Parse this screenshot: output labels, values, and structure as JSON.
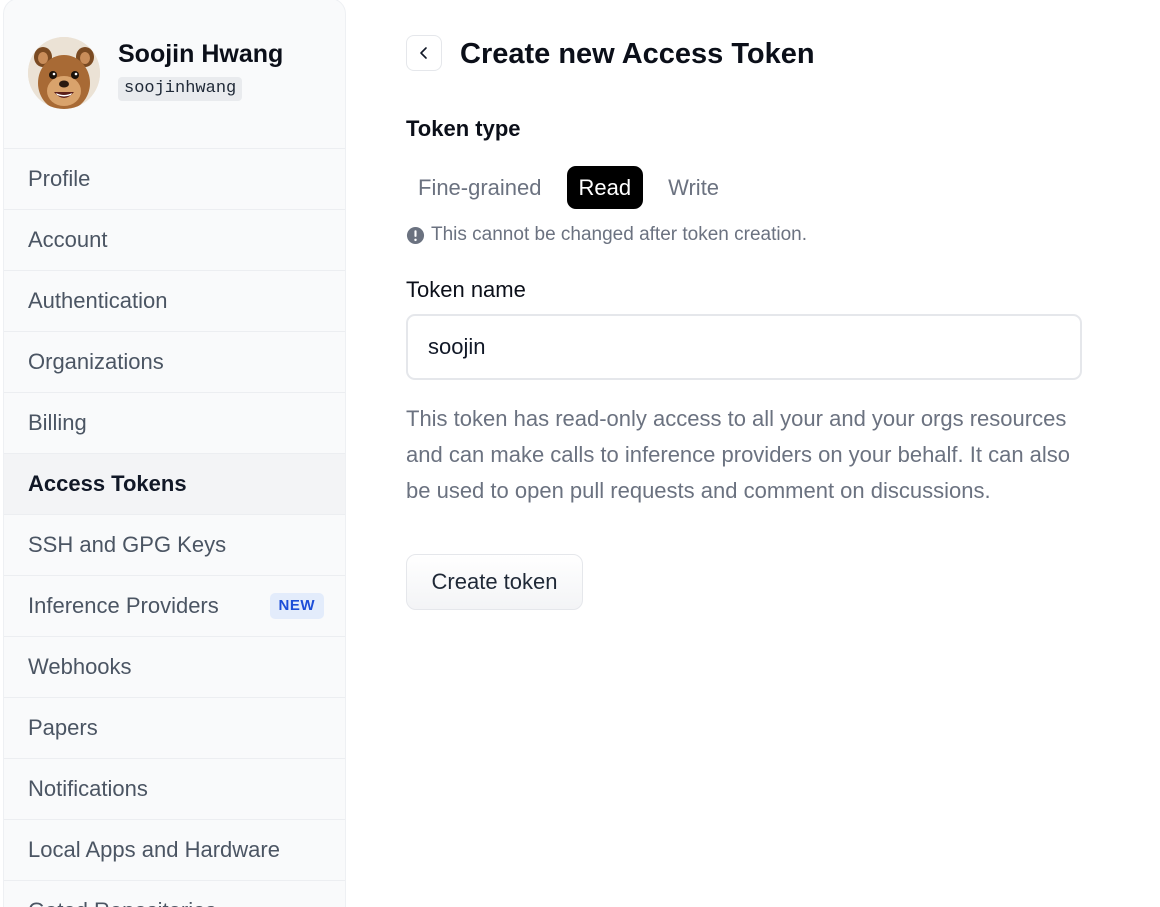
{
  "profile": {
    "name": "Soojin Hwang",
    "handle": "soojinhwang"
  },
  "sidebar": {
    "items": [
      {
        "label": "Profile"
      },
      {
        "label": "Account"
      },
      {
        "label": "Authentication"
      },
      {
        "label": "Organizations"
      },
      {
        "label": "Billing"
      },
      {
        "label": "Access Tokens",
        "active": true
      },
      {
        "label": "SSH and GPG Keys"
      },
      {
        "label": "Inference Providers",
        "badge": "NEW"
      },
      {
        "label": "Webhooks"
      },
      {
        "label": "Papers"
      },
      {
        "label": "Notifications"
      },
      {
        "label": "Local Apps and Hardware"
      },
      {
        "label": "Gated Repositories"
      }
    ]
  },
  "main": {
    "title": "Create new Access Token",
    "back_icon": "chevron-left-icon",
    "token_type": {
      "label": "Token type",
      "options": [
        "Fine-grained",
        "Read",
        "Write"
      ],
      "selected": "Read",
      "hint_icon": "exclamation-circle-icon",
      "hint": "This cannot be changed after token creation."
    },
    "token_name": {
      "label": "Token name",
      "value": "soojin"
    },
    "description": "This token has read-only access to all your and your orgs resources and can make calls to inference providers on your behalf. It can also be used to open pull requests and comment on discussions.",
    "create_button": "Create token"
  },
  "colors": {
    "sidebar_bg": "#f9fafb",
    "active_segment": "#000000",
    "badge_text": "#1d4ed8",
    "badge_bg": "#e3ecfb",
    "muted_text": "#6b7280"
  }
}
